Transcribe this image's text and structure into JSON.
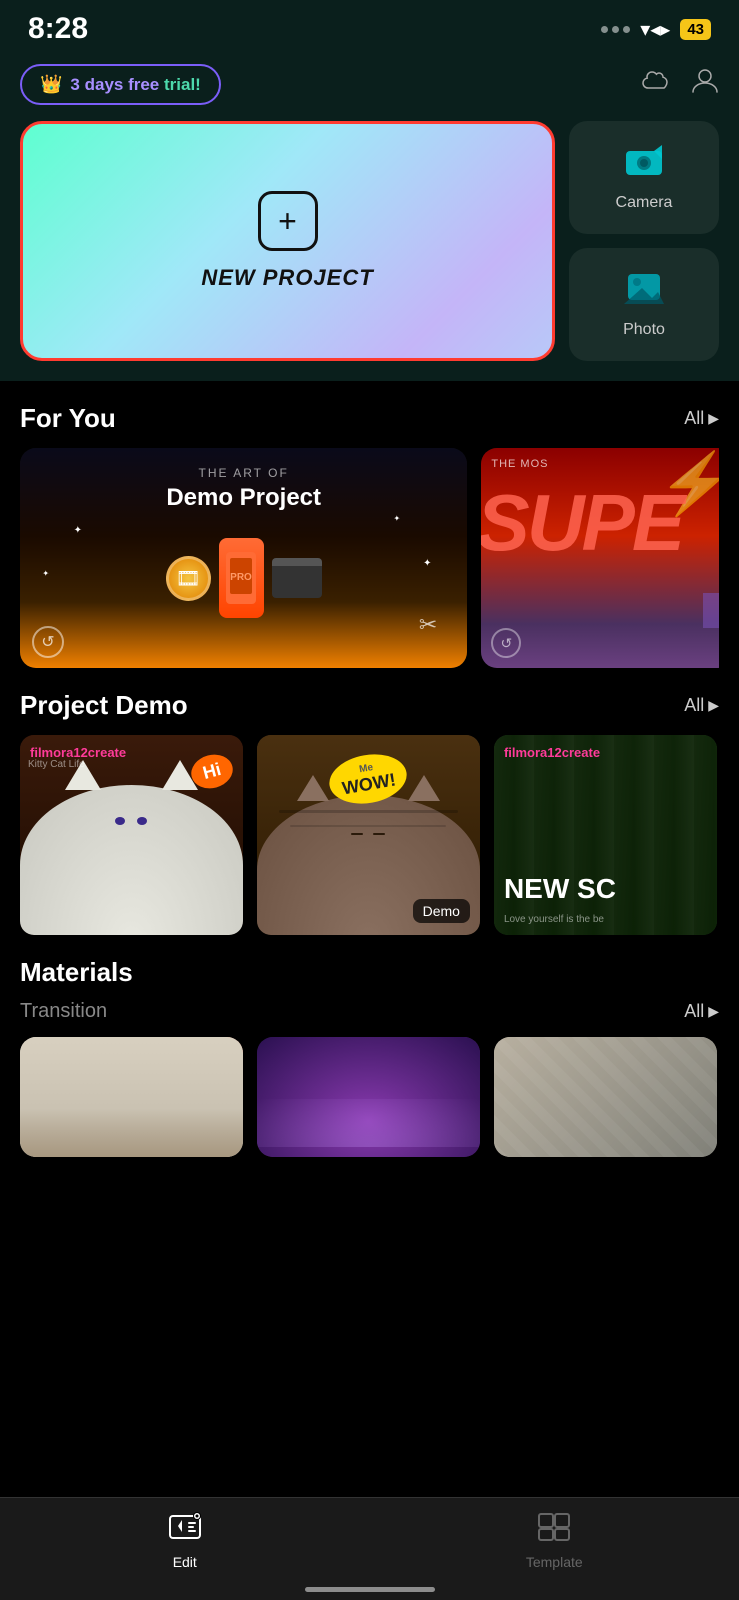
{
  "statusBar": {
    "time": "8:28",
    "battery": "43"
  },
  "topBar": {
    "trialText": "3 days free trial!",
    "trialFree": "3 days free",
    "trialTrial": " trial!",
    "cloudIcon": "☁",
    "profileIcon": "👤"
  },
  "newProject": {
    "label": "NEW PROJECT"
  },
  "sideButtons": [
    {
      "icon": "📹",
      "label": "Camera"
    },
    {
      "icon": "🖼",
      "label": "Photo"
    }
  ],
  "forYou": {
    "title": "For You",
    "allLabel": "All",
    "cards": [
      {
        "subtitle": "THE ART OF",
        "title": "Demo Project"
      },
      {
        "subtitle": "THE MOS",
        "title": "SUPE"
      }
    ]
  },
  "projectDemo": {
    "title": "Project Demo",
    "allLabel": "All",
    "items": [
      {
        "tag": "filmora12create",
        "kittyTag": "Kitty Cat Life",
        "bubble": "Hi",
        "badge": ""
      },
      {
        "tag": "",
        "bubble": "WOW!",
        "badge": "Demo"
      },
      {
        "tag": "filmora12create",
        "newText": "NEW SC",
        "loveText": "Love yourself is the be",
        "badge": ""
      }
    ]
  },
  "materials": {
    "title": "Materials",
    "transition": {
      "label": "Transition",
      "allLabel": "All"
    },
    "cards": [
      {
        "hot": true
      },
      {
        "hot": false
      },
      {
        "hot": false
      }
    ]
  },
  "tabBar": {
    "tabs": [
      {
        "icon": "▶",
        "label": "Edit",
        "active": true
      },
      {
        "icon": "⊞",
        "label": "Template",
        "active": false
      }
    ]
  }
}
